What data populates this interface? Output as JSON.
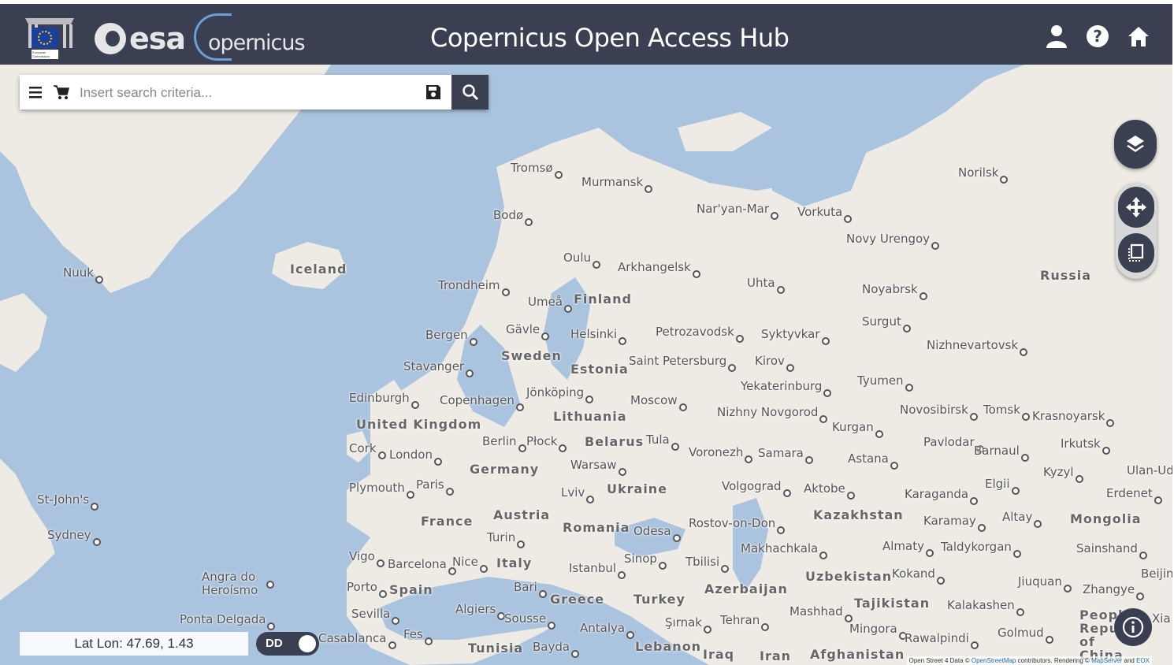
{
  "header": {
    "title": "Copernicus Open Access Hub",
    "esa_text": "esa",
    "copernicus_text": "opernicus",
    "ec_caption": "European Commission",
    "icons": [
      "user-icon",
      "help-icon",
      "home-icon"
    ]
  },
  "search": {
    "placeholder": "Insert search criteria...",
    "value": ""
  },
  "map": {
    "labels": [
      {
        "text": "Nuuk",
        "kind": "city"
      },
      {
        "text": "Iceland",
        "kind": "country"
      },
      {
        "text": "Tromsø",
        "kind": "city"
      },
      {
        "text": "Murmansk",
        "kind": "city"
      },
      {
        "text": "Bodø",
        "kind": "city"
      },
      {
        "text": "Nar'yan-Mar",
        "kind": "city"
      },
      {
        "text": "Vorkuta",
        "kind": "city"
      },
      {
        "text": "Norilsk",
        "kind": "city"
      },
      {
        "text": "Novy Urengoy",
        "kind": "city"
      },
      {
        "text": "Oulu",
        "kind": "city"
      },
      {
        "text": "Arkhangelsk",
        "kind": "city"
      },
      {
        "text": "Trondheim",
        "kind": "city"
      },
      {
        "text": "Umeå",
        "kind": "city"
      },
      {
        "text": "Finland",
        "kind": "country"
      },
      {
        "text": "Uhta",
        "kind": "city"
      },
      {
        "text": "Noyabrsk",
        "kind": "city"
      },
      {
        "text": "Russia",
        "kind": "country"
      },
      {
        "text": "Bergen",
        "kind": "city"
      },
      {
        "text": "Gävle",
        "kind": "city"
      },
      {
        "text": "Helsinki",
        "kind": "city"
      },
      {
        "text": "Petrozavodsk",
        "kind": "city"
      },
      {
        "text": "Syktyvkar",
        "kind": "city"
      },
      {
        "text": "Surgut",
        "kind": "city"
      },
      {
        "text": "Nizhnevartovsk",
        "kind": "city"
      },
      {
        "text": "Stavanger",
        "kind": "city"
      },
      {
        "text": "Sweden",
        "kind": "country"
      },
      {
        "text": "Estonia",
        "kind": "country"
      },
      {
        "text": "Saint Petersburg",
        "kind": "city"
      },
      {
        "text": "Kirov",
        "kind": "city"
      },
      {
        "text": "Tyumen",
        "kind": "city"
      },
      {
        "text": "Edinburgh",
        "kind": "city"
      },
      {
        "text": "Copenhagen",
        "kind": "city"
      },
      {
        "text": "Jönköping",
        "kind": "city"
      },
      {
        "text": "Moscow",
        "kind": "city"
      },
      {
        "text": "Yekaterinburg",
        "kind": "city"
      },
      {
        "text": "United Kingdom",
        "kind": "country"
      },
      {
        "text": "Lithuania",
        "kind": "country"
      },
      {
        "text": "Nizhny Novgorod",
        "kind": "city"
      },
      {
        "text": "Kurgan",
        "kind": "city"
      },
      {
        "text": "Novosibirsk",
        "kind": "city"
      },
      {
        "text": "Tomsk",
        "kind": "city"
      },
      {
        "text": "Krasnoyarsk",
        "kind": "city"
      },
      {
        "text": "Cork",
        "kind": "city"
      },
      {
        "text": "London",
        "kind": "city"
      },
      {
        "text": "Berlin",
        "kind": "city"
      },
      {
        "text": "Płock",
        "kind": "city"
      },
      {
        "text": "Belarus",
        "kind": "country"
      },
      {
        "text": "Tula",
        "kind": "city"
      },
      {
        "text": "Voronezh",
        "kind": "city"
      },
      {
        "text": "Samara",
        "kind": "city"
      },
      {
        "text": "Astana",
        "kind": "city"
      },
      {
        "text": "Pavlodar",
        "kind": "city"
      },
      {
        "text": "Barnaul",
        "kind": "city"
      },
      {
        "text": "Irkutsk",
        "kind": "city"
      },
      {
        "text": "Germany",
        "kind": "country"
      },
      {
        "text": "Warsaw",
        "kind": "city"
      },
      {
        "text": "Kyzyl",
        "kind": "city"
      },
      {
        "text": "Ulan-Ud",
        "kind": "city"
      },
      {
        "text": "Plymouth",
        "kind": "city"
      },
      {
        "text": "Paris",
        "kind": "city"
      },
      {
        "text": "Lviv",
        "kind": "city"
      },
      {
        "text": "Ukraine",
        "kind": "country"
      },
      {
        "text": "Volgograd",
        "kind": "city"
      },
      {
        "text": "Aktobe",
        "kind": "city"
      },
      {
        "text": "Karaganda",
        "kind": "city"
      },
      {
        "text": "Elgii",
        "kind": "city"
      },
      {
        "text": "Erdenet",
        "kind": "city"
      },
      {
        "text": "St-John's",
        "kind": "city"
      },
      {
        "text": "France",
        "kind": "country"
      },
      {
        "text": "Austria",
        "kind": "country"
      },
      {
        "text": "Romania",
        "kind": "country"
      },
      {
        "text": "Rostov-on-Don",
        "kind": "city"
      },
      {
        "text": "Kazakhstan",
        "kind": "country"
      },
      {
        "text": "Karamay",
        "kind": "city"
      },
      {
        "text": "Altay",
        "kind": "city"
      },
      {
        "text": "Mongolia",
        "kind": "country"
      },
      {
        "text": "Sydney",
        "kind": "city"
      },
      {
        "text": "Turin",
        "kind": "city"
      },
      {
        "text": "Odesa",
        "kind": "city"
      },
      {
        "text": "Makhachkala",
        "kind": "city"
      },
      {
        "text": "Almaty",
        "kind": "city"
      },
      {
        "text": "Taldykorgan",
        "kind": "city"
      },
      {
        "text": "Sainshand",
        "kind": "city"
      },
      {
        "text": "Vigo",
        "kind": "city"
      },
      {
        "text": "Barcelona",
        "kind": "city"
      },
      {
        "text": "Nice",
        "kind": "city"
      },
      {
        "text": "Italy",
        "kind": "country"
      },
      {
        "text": "Istanbul",
        "kind": "city"
      },
      {
        "text": "Sinop",
        "kind": "city"
      },
      {
        "text": "Tbilisi",
        "kind": "city"
      },
      {
        "text": "Uzbekistan",
        "kind": "country"
      },
      {
        "text": "Kokand",
        "kind": "city"
      },
      {
        "text": "Jiuquan",
        "kind": "city"
      },
      {
        "text": "Zhangye",
        "kind": "city"
      },
      {
        "text": "Beijin",
        "kind": "city"
      },
      {
        "text": "Angra do Heroísmo",
        "kind": "city"
      },
      {
        "text": "Porto",
        "kind": "city"
      },
      {
        "text": "Spain",
        "kind": "country"
      },
      {
        "text": "Bari",
        "kind": "city"
      },
      {
        "text": "Greece",
        "kind": "country"
      },
      {
        "text": "Turkey",
        "kind": "country"
      },
      {
        "text": "Azerbaijan",
        "kind": "country"
      },
      {
        "text": "Tajikistan",
        "kind": "country"
      },
      {
        "text": "Kalakashen",
        "kind": "city"
      },
      {
        "text": "Ponta Delgada",
        "kind": "city"
      },
      {
        "text": "Sevilla",
        "kind": "city"
      },
      {
        "text": "Algiers",
        "kind": "city"
      },
      {
        "text": "Sousse",
        "kind": "city"
      },
      {
        "text": "Antalya",
        "kind": "city"
      },
      {
        "text": "Şırnak",
        "kind": "city"
      },
      {
        "text": "Tehran",
        "kind": "city"
      },
      {
        "text": "Mashhad",
        "kind": "city"
      },
      {
        "text": "Mingora",
        "kind": "city"
      },
      {
        "text": "Rawalpindi",
        "kind": "city"
      },
      {
        "text": "Golmud",
        "kind": "city"
      },
      {
        "text": "People's Republic of China",
        "kind": "country"
      },
      {
        "text": "Xia",
        "kind": "city"
      },
      {
        "text": "Casablanca",
        "kind": "city"
      },
      {
        "text": "Fes",
        "kind": "city"
      },
      {
        "text": "Tunisia",
        "kind": "country"
      },
      {
        "text": "Bayda",
        "kind": "city"
      },
      {
        "text": "Lebanon",
        "kind": "country"
      },
      {
        "text": "Iraq",
        "kind": "country"
      },
      {
        "text": "Iran",
        "kind": "country"
      },
      {
        "text": "Afghanistan",
        "kind": "country"
      }
    ],
    "attribution_prefix": "Open Street 4 Data ©",
    "attribution_link1": "OpenStreetMap",
    "attribution_mid": "contributors. Rendering ©",
    "attribution_link2": "MapServer",
    "attribution_suffix": "and",
    "attribution_link3": "EOX"
  },
  "coords": {
    "label": "Lat Lon: 47.69, 1.43",
    "format": "DD"
  },
  "controls": [
    "layers-icon",
    "pan-icon",
    "select-area-icon",
    "info-icon"
  ]
}
